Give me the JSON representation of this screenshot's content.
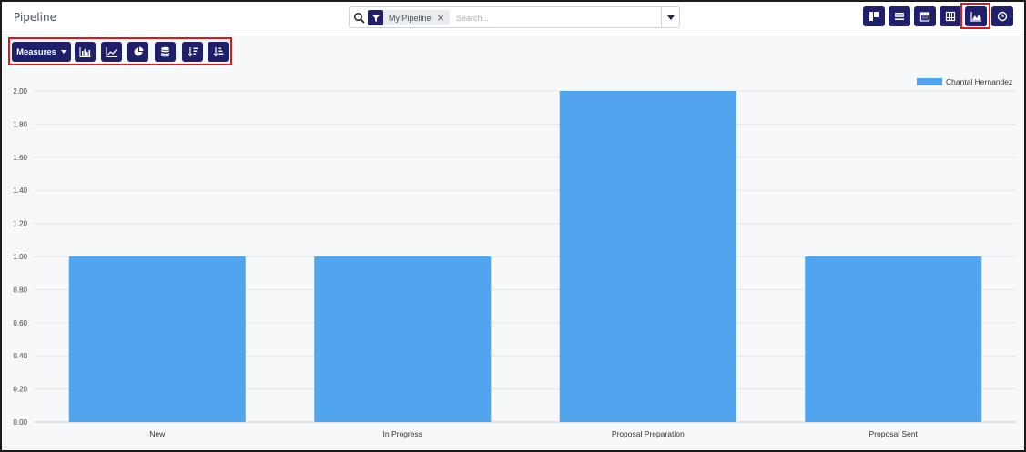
{
  "header": {
    "title": "Pipeline",
    "search": {
      "facet_label": "My Pipeline",
      "facet_remove": "×",
      "placeholder": "Search..."
    },
    "views": [
      {
        "name": "kanban-view",
        "icon": "kanban-icon"
      },
      {
        "name": "list-view",
        "icon": "list-icon"
      },
      {
        "name": "calendar-view",
        "icon": "calendar-icon"
      },
      {
        "name": "pivot-view",
        "icon": "pivot-table-icon"
      },
      {
        "name": "graph-view",
        "icon": "area-chart-icon",
        "active": true
      },
      {
        "name": "activity-view",
        "icon": "clock-icon"
      }
    ]
  },
  "toolbar": {
    "measures_label": "Measures",
    "buttons": [
      {
        "name": "bar-chart-button",
        "icon": "bar-chart-icon"
      },
      {
        "name": "line-chart-button",
        "icon": "line-chart-icon"
      },
      {
        "name": "pie-chart-button",
        "icon": "pie-chart-icon"
      },
      {
        "name": "stacked-button",
        "icon": "database-icon"
      },
      {
        "name": "sort-descending-button",
        "icon": "sort-descending-icon"
      },
      {
        "name": "sort-ascending-button",
        "icon": "sort-ascending-icon"
      }
    ]
  },
  "colors": {
    "brand": "#1f1f6b",
    "bar": "#50a5ee",
    "highlight": "#e0161a"
  },
  "chart_data": {
    "type": "bar",
    "categories": [
      "New",
      "In Progress",
      "Proposal Preparation",
      "Proposal Sent"
    ],
    "series": [
      {
        "name": "Chantal Hernandez",
        "values": [
          1,
          1,
          2,
          1
        ]
      }
    ],
    "yticks": [
      "0.00",
      "0.20",
      "0.40",
      "0.60",
      "0.80",
      "1.00",
      "1.20",
      "1.40",
      "1.60",
      "1.80",
      "2.00"
    ],
    "ylim": [
      0,
      2
    ],
    "grid": true,
    "legend": "top-right"
  }
}
